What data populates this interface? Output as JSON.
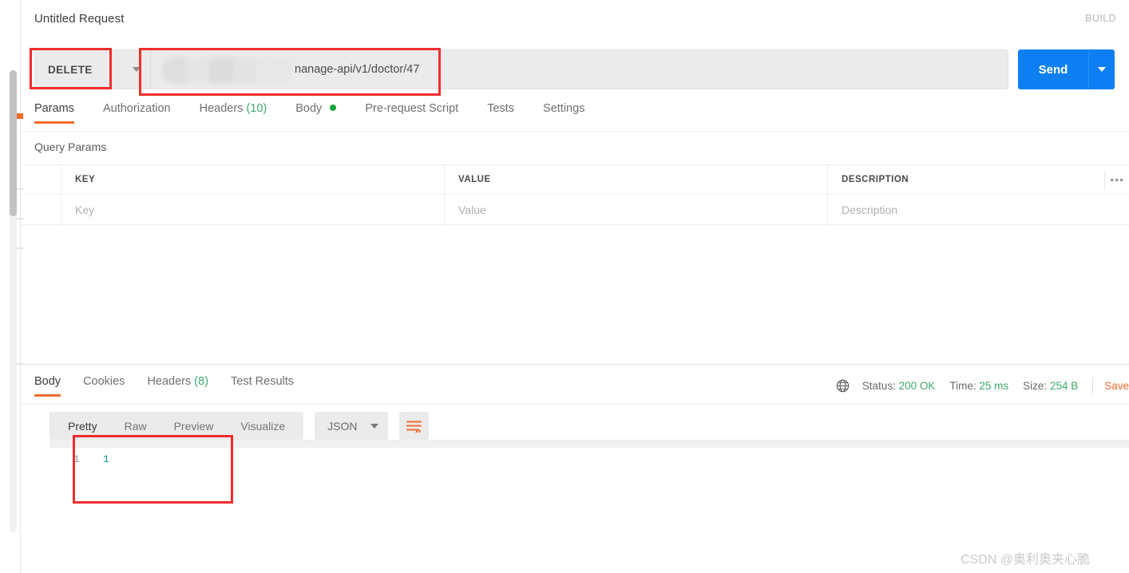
{
  "header": {
    "request_title": "Untitled Request",
    "build_label": "BUILD"
  },
  "url_bar": {
    "method": "DELETE",
    "method_caret_icon": "chevron-down-icon",
    "url_redacted_placeholder": "",
    "url_visible_text": "nanage-api/v1/doctor/47",
    "send_label": "Send",
    "send_caret_icon": "chevron-down-icon"
  },
  "request_tabs": [
    {
      "label": "Params",
      "active": true,
      "count": "",
      "dot": false
    },
    {
      "label": "Authorization",
      "active": false,
      "count": "",
      "dot": false
    },
    {
      "label": "Headers",
      "active": false,
      "count": "(10)",
      "dot": false
    },
    {
      "label": "Body",
      "active": false,
      "count": "",
      "dot": true
    },
    {
      "label": "Pre-request Script",
      "active": false,
      "count": "",
      "dot": false
    },
    {
      "label": "Tests",
      "active": false,
      "count": "",
      "dot": false
    },
    {
      "label": "Settings",
      "active": false,
      "count": "",
      "dot": false
    }
  ],
  "query_params": {
    "section_label": "Query Params",
    "columns": [
      "KEY",
      "VALUE",
      "DESCRIPTION"
    ],
    "bulk_icon": "•••",
    "rows": [
      {
        "key": "Key",
        "value": "Value",
        "description": "Description"
      }
    ]
  },
  "response_tabs": [
    {
      "label": "Body",
      "active": true,
      "count": ""
    },
    {
      "label": "Cookies",
      "active": false,
      "count": ""
    },
    {
      "label": "Headers",
      "active": false,
      "count": "(8)"
    },
    {
      "label": "Test Results",
      "active": false,
      "count": ""
    }
  ],
  "response_meta": {
    "globe_icon": "globe-icon",
    "status_label": "Status:",
    "status_value": "200 OK",
    "time_label": "Time:",
    "time_value": "25 ms",
    "size_label": "Size:",
    "size_value": "254 B",
    "save_label": "Save"
  },
  "viewer_toolbar": {
    "format_tabs": [
      {
        "label": "Pretty",
        "active": true
      },
      {
        "label": "Raw",
        "active": false
      },
      {
        "label": "Preview",
        "active": false
      },
      {
        "label": "Visualize",
        "active": false
      }
    ],
    "language": "JSON",
    "language_caret_icon": "chevron-down-icon",
    "wrap_icon": "wrap-text-icon"
  },
  "response_body": {
    "line_number": "1",
    "content": "1"
  },
  "watermark": {
    "text": "CSDN @奥利奥夹心脆"
  },
  "colors": {
    "accent_orange": "#ef6c2e",
    "send_blue": "#0d7ff2",
    "status_green": "#3ea86b",
    "annotation_red": "#f02d2d",
    "json_number": "#0b9b86"
  }
}
